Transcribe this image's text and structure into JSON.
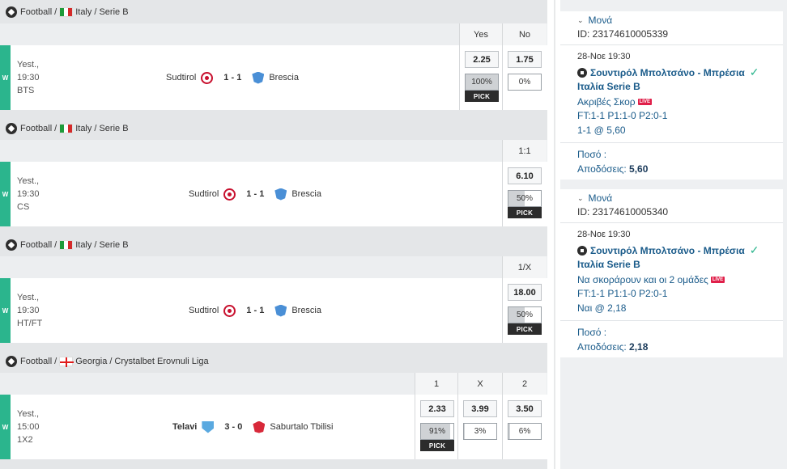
{
  "events": [
    {
      "sport": "Football",
      "country": "Italy",
      "league": "Serie B",
      "flag": "italy",
      "columns": [
        "Yes",
        "No"
      ],
      "result": "W",
      "time": [
        "Yest.,",
        "19:30",
        "BTS"
      ],
      "home": "Sudtirol",
      "away": "Brescia",
      "score": "1 - 1",
      "home_bold": false,
      "odds": [
        {
          "odd": "2.25",
          "pct": "100%",
          "pct_value": 100,
          "pick": true
        },
        {
          "odd": "1.75",
          "pct": "0%",
          "pct_value": 0,
          "pick": false
        }
      ]
    },
    {
      "sport": "Football",
      "country": "Italy",
      "league": "Serie B",
      "flag": "italy",
      "columns": [
        "1:1"
      ],
      "result": "W",
      "time": [
        "Yest.,",
        "19:30",
        "CS"
      ],
      "home": "Sudtirol",
      "away": "Brescia",
      "score": "1 - 1",
      "home_bold": false,
      "odds": [
        {
          "odd": "6.10",
          "pct": "50%",
          "pct_value": 50,
          "pick": true
        }
      ]
    },
    {
      "sport": "Football",
      "country": "Italy",
      "league": "Serie B",
      "flag": "italy",
      "columns": [
        "1/X"
      ],
      "result": "W",
      "time": [
        "Yest.,",
        "19:30",
        "HT/FT"
      ],
      "home": "Sudtirol",
      "away": "Brescia",
      "score": "1 - 1",
      "home_bold": false,
      "odds": [
        {
          "odd": "18.00",
          "pct": "50%",
          "pct_value": 50,
          "pick": true
        }
      ]
    },
    {
      "sport": "Football",
      "country": "Georgia",
      "league": "Crystalbet Erovnuli Liga",
      "flag": "georgia",
      "columns": [
        "1",
        "X",
        "2"
      ],
      "result": "W",
      "time": [
        "Yest.,",
        "15:00",
        "1X2"
      ],
      "home": "Telavi",
      "away": "Saburtalo Tbilisi",
      "score": "3 - 0",
      "home_bold": true,
      "odds": [
        {
          "odd": "2.33",
          "pct": "91%",
          "pct_value": 91,
          "pick": true
        },
        {
          "odd": "3.99",
          "pct": "3%",
          "pct_value": 3,
          "pick": false
        },
        {
          "odd": "3.50",
          "pct": "6%",
          "pct_value": 6,
          "pick": false
        }
      ]
    }
  ],
  "pick_label": "PICK",
  "separator": "/",
  "slips": [
    {
      "type": "Μονά",
      "id": "ID: 23174610005339",
      "date": "28-Νοε 19:30",
      "teams": "Σουντιρόλ Μπολτσάνο - Μπρέσια",
      "league": "Ιταλία Serie B",
      "market": "Ακριβές Σκορ",
      "live": "LIVE",
      "result": "FT:1-1 P1:1-0 P2:0-1",
      "selection": "1-1 @ 5,60",
      "amount_label": "Ποσό :",
      "returns_label": "Αποδόσεις:",
      "returns_value": "5,60"
    },
    {
      "type": "Μονά",
      "id": "ID: 23174610005340",
      "date": "28-Νοε 19:30",
      "teams": "Σουντιρόλ Μπολτσάνο - Μπρέσια",
      "league": "Ιταλία Serie B",
      "market": "Να σκοράρουν και οι 2 ομάδες",
      "live": "LIVE",
      "result": "FT:1-1 P1:1-0 P2:0-1",
      "selection": "Ναι @ 2,18",
      "amount_label": "Ποσό :",
      "returns_label": "Αποδόσεις:",
      "returns_value": "2,18"
    }
  ]
}
